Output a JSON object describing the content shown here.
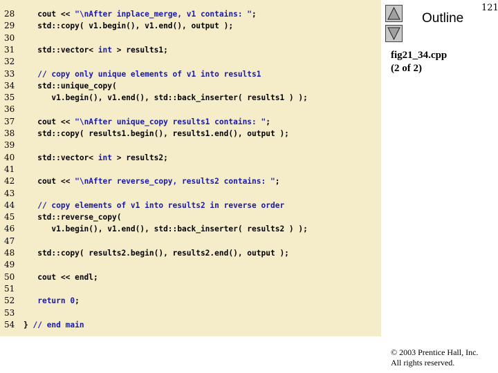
{
  "slide_number": "121",
  "outline": {
    "title": "Outline"
  },
  "file": {
    "name": "fig21_34.cpp",
    "part": "(2 of 2)"
  },
  "copyright": {
    "line1": "© 2003 Prentice Hall, Inc.",
    "line2": "All rights reserved."
  },
  "icons": {
    "up": "triangle-up-icon",
    "down": "triangle-down-icon"
  },
  "colors": {
    "code_background": "#f5ecca",
    "keyword": "#1a1aa8"
  },
  "code": {
    "lines": [
      {
        "n": "28",
        "tokens": [
          {
            "t": "   cout << ",
            "c": ""
          },
          {
            "t": "\"\\nAfter inplace_merge, v1 contains: \"",
            "c": "str"
          },
          {
            "t": ";",
            "c": ""
          }
        ]
      },
      {
        "n": "29",
        "tokens": [
          {
            "t": "   std::copy( v1.begin(), v1.end(), output );",
            "c": ""
          }
        ]
      },
      {
        "n": "30",
        "tokens": []
      },
      {
        "n": "31",
        "tokens": [
          {
            "t": "   std::vector< ",
            "c": ""
          },
          {
            "t": "int",
            "c": "kw"
          },
          {
            "t": " > results1;",
            "c": ""
          }
        ]
      },
      {
        "n": "32",
        "tokens": []
      },
      {
        "n": "33",
        "tokens": [
          {
            "t": "   // copy only unique elements of v1 into results1",
            "c": "cmt"
          }
        ]
      },
      {
        "n": "34",
        "tokens": [
          {
            "t": "   std::unique_copy(",
            "c": ""
          }
        ]
      },
      {
        "n": "35",
        "tokens": [
          {
            "t": "      v1.begin(), v1.end(), std::back_inserter( results1 ) );",
            "c": ""
          }
        ]
      },
      {
        "n": "36",
        "tokens": []
      },
      {
        "n": "37",
        "tokens": [
          {
            "t": "   cout << ",
            "c": ""
          },
          {
            "t": "\"\\nAfter unique_copy results1 contains: \"",
            "c": "str"
          },
          {
            "t": ";",
            "c": ""
          }
        ]
      },
      {
        "n": "38",
        "tokens": [
          {
            "t": "   std::copy( results1.begin(), results1.end(), output );",
            "c": ""
          }
        ]
      },
      {
        "n": "39",
        "tokens": []
      },
      {
        "n": "40",
        "tokens": [
          {
            "t": "   std::vector< ",
            "c": ""
          },
          {
            "t": "int",
            "c": "kw"
          },
          {
            "t": " > results2;",
            "c": ""
          }
        ]
      },
      {
        "n": "41",
        "tokens": []
      },
      {
        "n": "42",
        "tokens": [
          {
            "t": "   cout << ",
            "c": ""
          },
          {
            "t": "\"\\nAfter reverse_copy, results2 contains: \"",
            "c": "str"
          },
          {
            "t": ";",
            "c": ""
          }
        ]
      },
      {
        "n": "43",
        "tokens": []
      },
      {
        "n": "44",
        "tokens": [
          {
            "t": "   // copy elements of v1 into results2 in reverse order",
            "c": "cmt"
          }
        ]
      },
      {
        "n": "45",
        "tokens": [
          {
            "t": "   std::reverse_copy(",
            "c": ""
          }
        ]
      },
      {
        "n": "46",
        "tokens": [
          {
            "t": "      v1.begin(), v1.end(), std::back_inserter( results2 ) );",
            "c": ""
          }
        ]
      },
      {
        "n": "47",
        "tokens": []
      },
      {
        "n": "48",
        "tokens": [
          {
            "t": "   std::copy( results2.begin(), results2.end(), output );",
            "c": ""
          }
        ]
      },
      {
        "n": "49",
        "tokens": []
      },
      {
        "n": "50",
        "tokens": [
          {
            "t": "   cout << endl;",
            "c": ""
          }
        ]
      },
      {
        "n": "51",
        "tokens": []
      },
      {
        "n": "52",
        "tokens": [
          {
            "t": "   ",
            "c": ""
          },
          {
            "t": "return",
            "c": "kw"
          },
          {
            "t": " ",
            "c": ""
          },
          {
            "t": "0",
            "c": "num"
          },
          {
            "t": ";",
            "c": ""
          }
        ]
      },
      {
        "n": "53",
        "tokens": []
      },
      {
        "n": "54",
        "tokens": [
          {
            "t": "} ",
            "c": ""
          },
          {
            "t": "// end main",
            "c": "cmt"
          }
        ]
      }
    ]
  }
}
